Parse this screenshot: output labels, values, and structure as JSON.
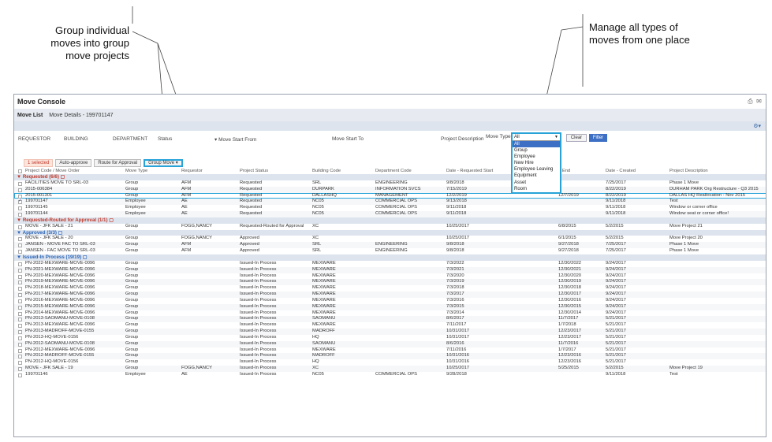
{
  "callouts": {
    "left": "Group individual moves into group move projects",
    "right": "Manage all types of moves from one place"
  },
  "window": {
    "title": "Move Console",
    "icons": [
      "print-icon",
      "email-icon"
    ]
  },
  "tabs": [
    {
      "label": "Move List",
      "active": true
    },
    {
      "label": "Move Details - 199701147",
      "active": false
    }
  ],
  "settings_icon": "gear-icon",
  "filters": {
    "requestor": "REQUESTOR",
    "building": "BUILDING",
    "department": "DEPARTMENT",
    "status": "Status",
    "move_start_from": "▾ Move Start From",
    "move_start_to": "Move Start To",
    "project_description": "Project Description",
    "move_type_label": "Move Type",
    "move_type_value": "All",
    "clear": "Clear",
    "filter": "Filter"
  },
  "move_type_options": [
    "All",
    "Group",
    "Employee",
    "New Hire",
    "Employee Leaving",
    "Equipment",
    "Asset",
    "Room"
  ],
  "toolbar": {
    "selected": "1 selected",
    "auto_approve": "Auto-approve",
    "route_for_approval": "Route for Approval",
    "group_move": "Group Move ▾"
  },
  "columns": [
    "Project Code / Move Order",
    "Move Type",
    "Requestor",
    "Project Status",
    "Building Code",
    "Department Code",
    "Date - Requested Start",
    "Date - Requested End",
    "Date - Created",
    "Project Description"
  ],
  "columns_visible": [
    "Project Code / Move Order",
    "Move Type",
    "Requestor",
    "Project Status",
    "Building Code",
    "Department Code",
    "Date - Requested Start",
    "d End",
    "Date - Created",
    "Project Description"
  ],
  "groups": [
    {
      "label": "Requested (6/6)",
      "color": "red",
      "rows": [
        [
          "FACILITIES MOVE TO SRL-03",
          "Group",
          "AFM",
          "Requested",
          "SRL",
          "ENGINEERING",
          "9/8/2018",
          "",
          "7/25/2017",
          "Phase 1 Move"
        ],
        [
          "2015-006384",
          "Group",
          "AFM",
          "Requested",
          "DURPARK",
          "INFORMATION SVCS",
          "7/15/2019",
          "",
          "8/22/2019",
          "DURHAM PARK Org Restructure - Q3 2015"
        ],
        [
          "2015-001301",
          "Group",
          "AFM",
          "Requested",
          "DALLASHQ",
          "MANAGEMENT",
          "12/2/2019",
          "12/7/2019",
          "8/22/2019",
          "DALLAS HQ Reallocation - Nov 2015"
        ],
        [
          "199701147",
          "Employee",
          "AE",
          "Requested",
          "NC05",
          "COMMERCIAL OPS",
          "9/13/2018",
          "",
          "9/11/2018",
          "Test"
        ],
        [
          "199701145",
          "Employee",
          "AE",
          "Requested",
          "NC05",
          "COMMERCIAL OPS",
          "9/11/2018",
          "",
          "9/11/2018",
          "Window or corner office"
        ],
        [
          "199701144",
          "Employee",
          "AE",
          "Requested",
          "NC05",
          "COMMERCIAL OPS",
          "9/11/2018",
          "",
          "9/11/2018",
          "Window seat or corner office!"
        ]
      ]
    },
    {
      "label": "Requested-Routed for Approval (1/1)",
      "color": "red",
      "rows": [
        [
          "MOVE - JFK SALE - 21",
          "Group",
          "FOGG,NANCY",
          "Requested-Routed for Approval",
          "XC",
          "",
          "10/25/2017",
          "6/8/2015",
          "5/2/2015",
          "Move Project 21"
        ]
      ]
    },
    {
      "label": "Approved (3/3)",
      "color": "blue",
      "rows": [
        [
          "MOVE - JFK SALE - 20",
          "Group",
          "FOGG,NANCY",
          "Approved",
          "XC",
          "",
          "10/25/2017",
          "6/1/2015",
          "5/2/2015",
          "Move Project 20"
        ],
        [
          "JANSEN - MOVE FAC TO SRL-03",
          "Group",
          "AFM",
          "Approved",
          "SRL",
          "ENGINEERING",
          "9/8/2018",
          "9/27/2018",
          "7/25/2017",
          "Phase 1 Move"
        ],
        [
          "JANSEN - FAC MOVE TO SRL-03",
          "Group",
          "AFM",
          "Approved",
          "SRL",
          "ENGINEERING",
          "9/8/2018",
          "9/27/2018",
          "7/25/2017",
          "Phase 1 Move"
        ]
      ]
    },
    {
      "label": "Issued-In Process (19/19)",
      "color": "blue",
      "rows": [
        [
          "PN-2022-MEXWARE-MOVE-0096",
          "Group",
          "",
          "Issued-In Process",
          "MEXWARE",
          "",
          "7/3/2022",
          "12/30/2022",
          "9/24/2017",
          ""
        ],
        [
          "PN-2021-MEXWARE-MOVE-0096",
          "Group",
          "",
          "Issued-In Process",
          "MEXWARE",
          "",
          "7/3/2021",
          "12/30/2021",
          "9/24/2017",
          ""
        ],
        [
          "PN-2020-MEXWARE-MOVE-0096",
          "Group",
          "",
          "Issued-In Process",
          "MEXWARE",
          "",
          "7/3/2020",
          "12/30/2020",
          "9/24/2017",
          ""
        ],
        [
          "PN-2019-MEXWARE-MOVE-0096",
          "Group",
          "",
          "Issued-In Process",
          "MEXWARE",
          "",
          "7/3/2019",
          "12/30/2019",
          "9/24/2017",
          ""
        ],
        [
          "PN-2018-MEXWARE-MOVE-0096",
          "Group",
          "",
          "Issued-In Process",
          "MEXWARE",
          "",
          "7/3/2018",
          "12/30/2018",
          "9/24/2017",
          ""
        ],
        [
          "PN-2017-MEXWARE-MOVE-0096",
          "Group",
          "",
          "Issued-In Process",
          "MEXWARE",
          "",
          "7/3/2017",
          "12/30/2017",
          "9/24/2017",
          ""
        ],
        [
          "PN-2016-MEXWARE-MOVE-0096",
          "Group",
          "",
          "Issued-In Process",
          "MEXWARE",
          "",
          "7/3/2016",
          "12/30/2016",
          "9/24/2017",
          ""
        ],
        [
          "PN-2015-MEXWARE-MOVE-0096",
          "Group",
          "",
          "Issued-In Process",
          "MEXWARE",
          "",
          "7/3/2015",
          "12/30/2015",
          "9/24/2017",
          ""
        ],
        [
          "PN-2014-MEXWARE-MOVE-0096",
          "Group",
          "",
          "Issued-In Process",
          "MEXWARE",
          "",
          "7/3/2014",
          "12/30/2014",
          "9/24/2017",
          ""
        ],
        [
          "PN-2013-SAOMANU-MOVE-0108",
          "Group",
          "",
          "Issued-In Process",
          "SAOMANU",
          "",
          "8/6/2017",
          "11/7/2017",
          "5/21/2017",
          ""
        ],
        [
          "PN-2013-MEXWARE-MOVE-0096",
          "Group",
          "",
          "Issued-In Process",
          "MEXWARE",
          "",
          "7/11/2017",
          "1/7/2018",
          "5/21/2017",
          ""
        ],
        [
          "PN-2013-MADROFF-MOVE-0155",
          "Group",
          "",
          "Issued-In Process",
          "MADROFF",
          "",
          "10/31/2017",
          "12/23/2017",
          "5/21/2017",
          ""
        ],
        [
          "PN-2013-HQ-MOVE-0156",
          "Group",
          "",
          "Issued-In Process",
          "HQ",
          "",
          "10/31/2017",
          "12/23/2017",
          "5/21/2017",
          ""
        ],
        [
          "PN-2012-SAOMANU-MOVE-0108",
          "Group",
          "",
          "Issued-In Process",
          "SAOMANU",
          "",
          "8/6/2016",
          "11/7/2016",
          "5/21/2017",
          ""
        ],
        [
          "PN-2012-MEXWARE-MOVE-0096",
          "Group",
          "",
          "Issued-In Process",
          "MEXWARE",
          "",
          "7/11/2016",
          "1/7/2017",
          "5/21/2017",
          ""
        ],
        [
          "PN-2012-MADROFF-MOVE-0155",
          "Group",
          "",
          "Issued-In Process",
          "MADROFF",
          "",
          "10/31/2016",
          "12/23/2016",
          "5/21/2017",
          ""
        ],
        [
          "PN-2012-HQ-MOVE-0156",
          "Group",
          "",
          "Issued-In Process",
          "HQ",
          "",
          "10/31/2016",
          "12/23/2016",
          "5/21/2017",
          ""
        ],
        [
          "MOVE - JFK SALE - 19",
          "Group",
          "FOGG,NANCY",
          "Issued-In Process",
          "XC",
          "",
          "10/25/2017",
          "5/25/2015",
          "5/2/2015",
          "Move Project 19"
        ],
        [
          "199701146",
          "Employee",
          "AE",
          "Issued-In Process",
          "NC05",
          "COMMERCIAL OPS",
          "9/28/2018",
          "",
          "9/11/2018",
          "Test"
        ]
      ]
    }
  ],
  "selected_row": "199701147",
  "highlighted_row": "2015-001301"
}
